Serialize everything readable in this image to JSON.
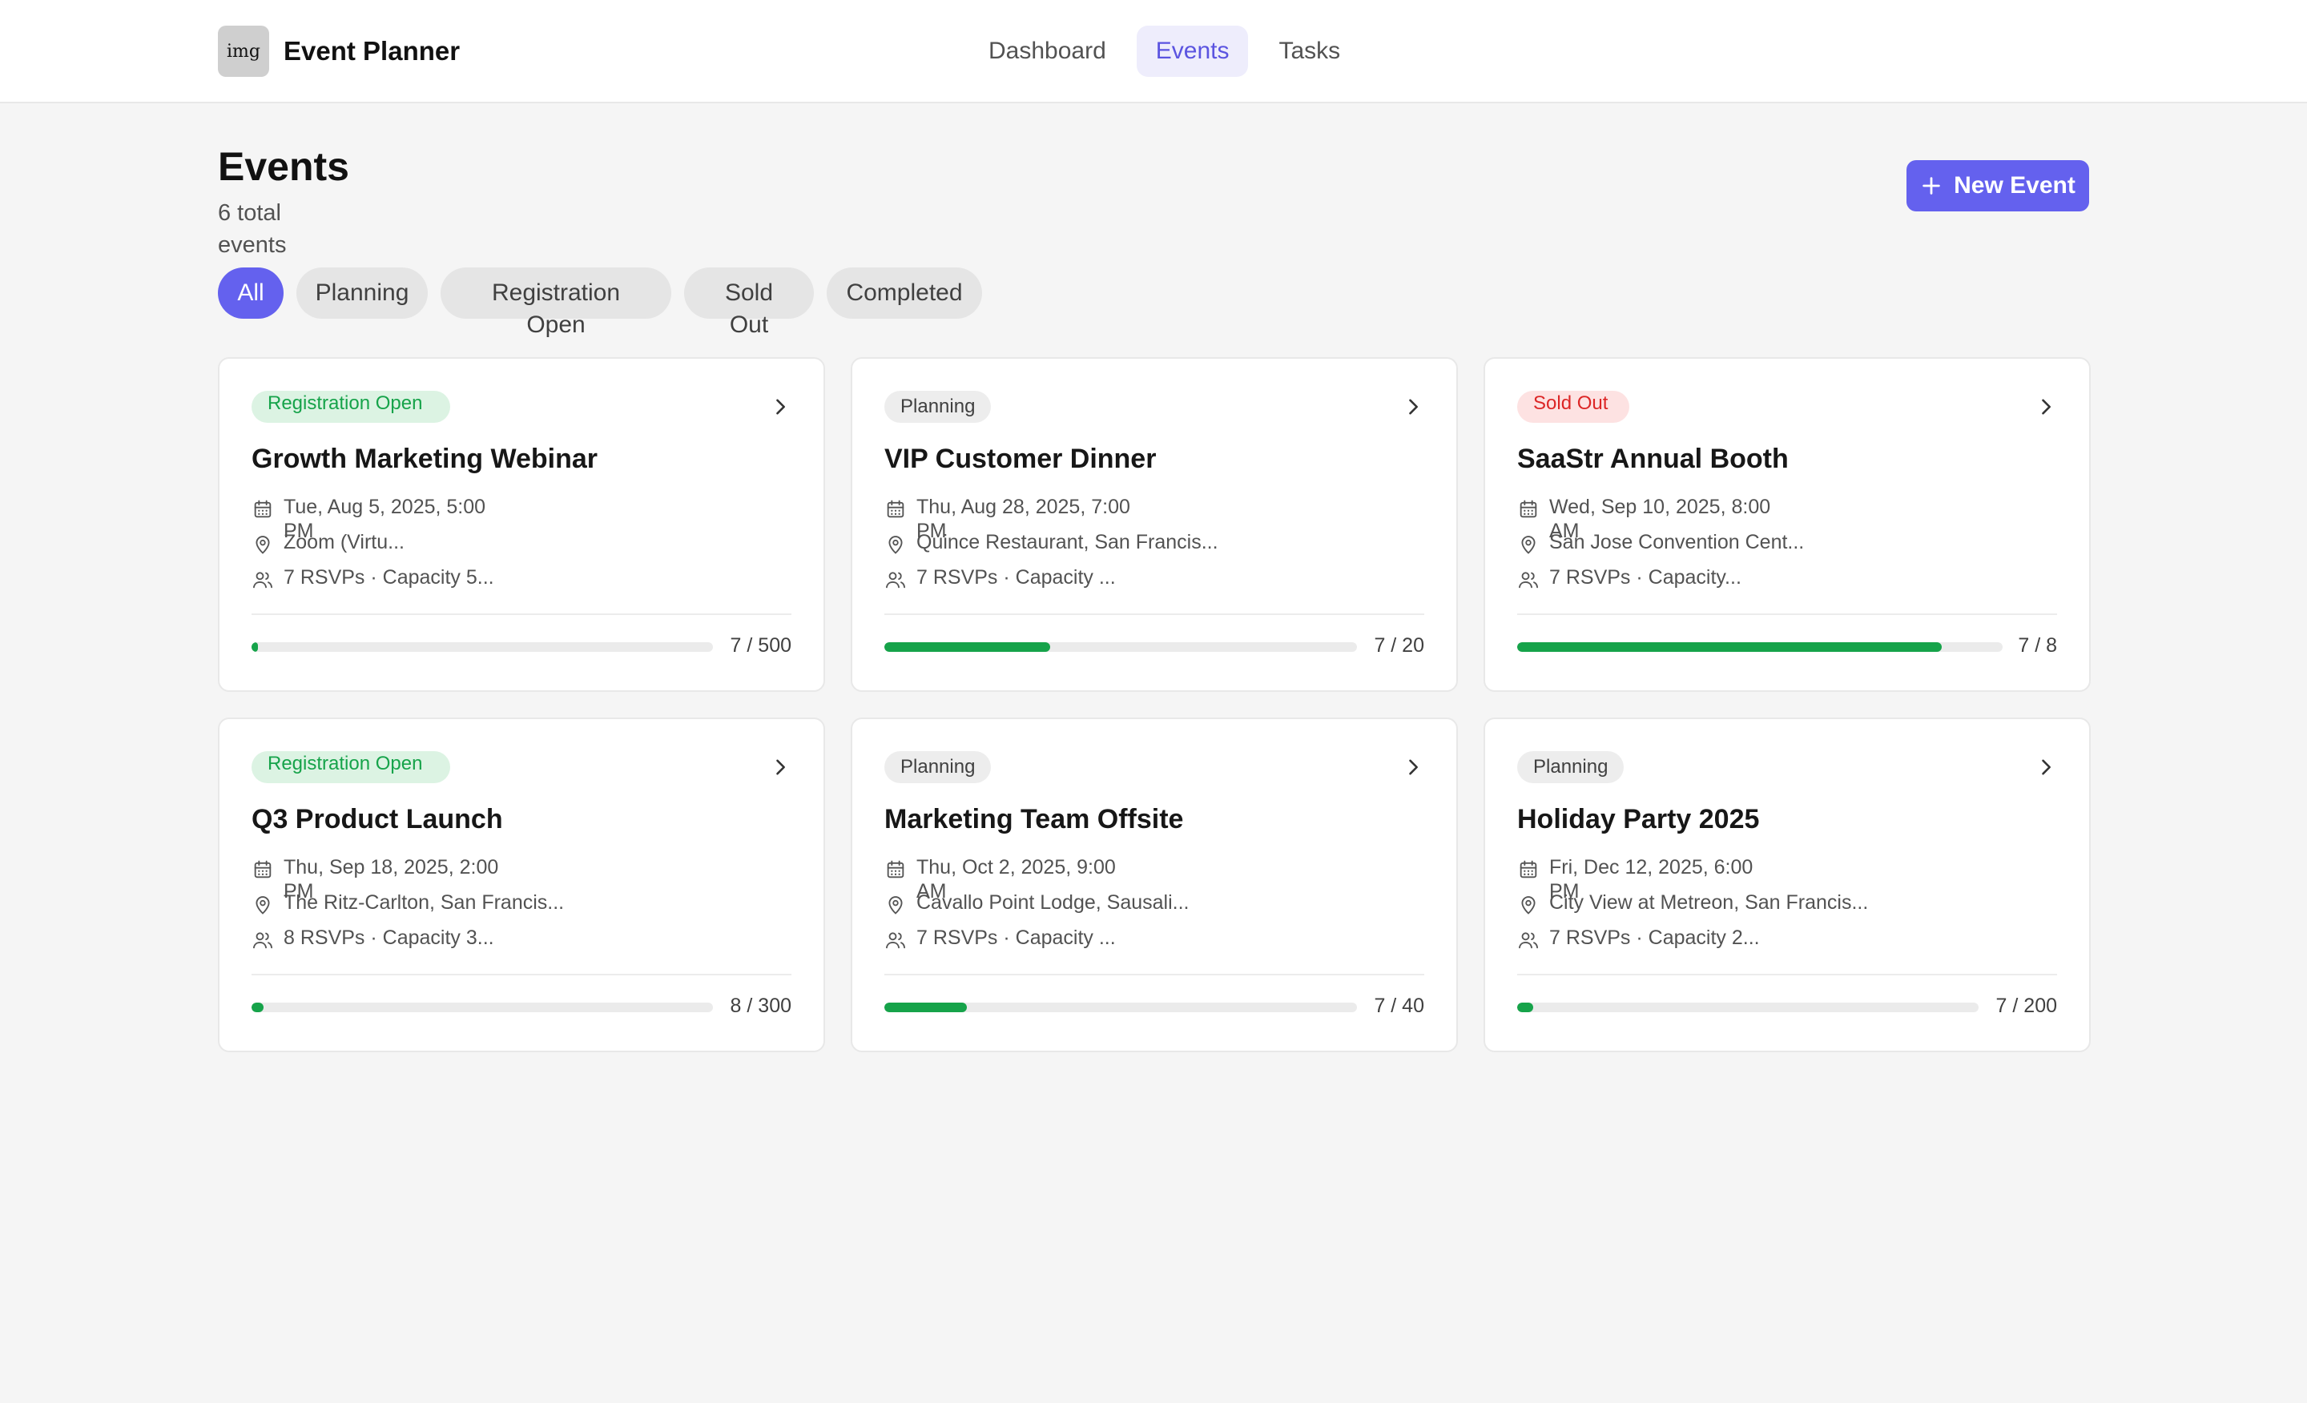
{
  "app": {
    "logo_text": "img",
    "title": "Event Planner"
  },
  "nav": [
    {
      "label": "Dashboard",
      "active": false
    },
    {
      "label": "Events",
      "active": true
    },
    {
      "label": "Tasks",
      "active": false
    }
  ],
  "page": {
    "title": "Events",
    "subtitle": "6 total events",
    "new_button_label": "New Event"
  },
  "filters": [
    {
      "label": "All",
      "active": true
    },
    {
      "label": "Planning",
      "active": false
    },
    {
      "label": "Registration Open",
      "active": false
    },
    {
      "label": "Sold Out",
      "active": false
    },
    {
      "label": "Completed",
      "active": false
    }
  ],
  "events": [
    {
      "status": "Registration Open",
      "title": "Growth Marketing Webinar",
      "date": "Tue, Aug 5, 2025, 5:00 PM",
      "location": "Zoom (Virtu...",
      "rsvp_text": "7 RSVPs · Capacity 5...",
      "rsvps": 7,
      "capacity": 500,
      "count_label": "7 / 500"
    },
    {
      "status": "Planning",
      "title": "VIP Customer Dinner",
      "date": "Thu, Aug 28, 2025, 7:00 PM",
      "location": "Quince Restaurant, San Francis...",
      "rsvp_text": "7 RSVPs · Capacity ...",
      "rsvps": 7,
      "capacity": 20,
      "count_label": "7 / 20"
    },
    {
      "status": "Sold Out",
      "title": "SaaStr Annual Booth",
      "date": "Wed, Sep 10, 2025, 8:00 AM",
      "location": "San Jose Convention Cent...",
      "rsvp_text": "7 RSVPs · Capacity...",
      "rsvps": 7,
      "capacity": 8,
      "count_label": "7 / 8"
    },
    {
      "status": "Registration Open",
      "title": "Q3 Product Launch",
      "date": "Thu, Sep 18, 2025, 2:00 PM",
      "location": "The Ritz-Carlton, San Francis...",
      "rsvp_text": "8 RSVPs · Capacity 3...",
      "rsvps": 8,
      "capacity": 300,
      "count_label": "8 / 300"
    },
    {
      "status": "Planning",
      "title": "Marketing Team Offsite",
      "date": "Thu, Oct 2, 2025, 9:00 AM",
      "location": "Cavallo Point Lodge, Sausali...",
      "rsvp_text": "7 RSVPs · Capacity ...",
      "rsvps": 7,
      "capacity": 40,
      "count_label": "7 / 40"
    },
    {
      "status": "Planning",
      "title": "Holiday Party 2025",
      "date": "Fri, Dec 12, 2025, 6:00 PM",
      "location": "City View at Metreon, San Francis...",
      "rsvp_text": "7 RSVPs · Capacity 2...",
      "rsvps": 7,
      "capacity": 200,
      "count_label": "7 / 200"
    }
  ],
  "colors": {
    "accent": "#6461ee",
    "progress": "#16a34a",
    "status_open": "#16a34a",
    "status_sold_out": "#dc2626"
  }
}
